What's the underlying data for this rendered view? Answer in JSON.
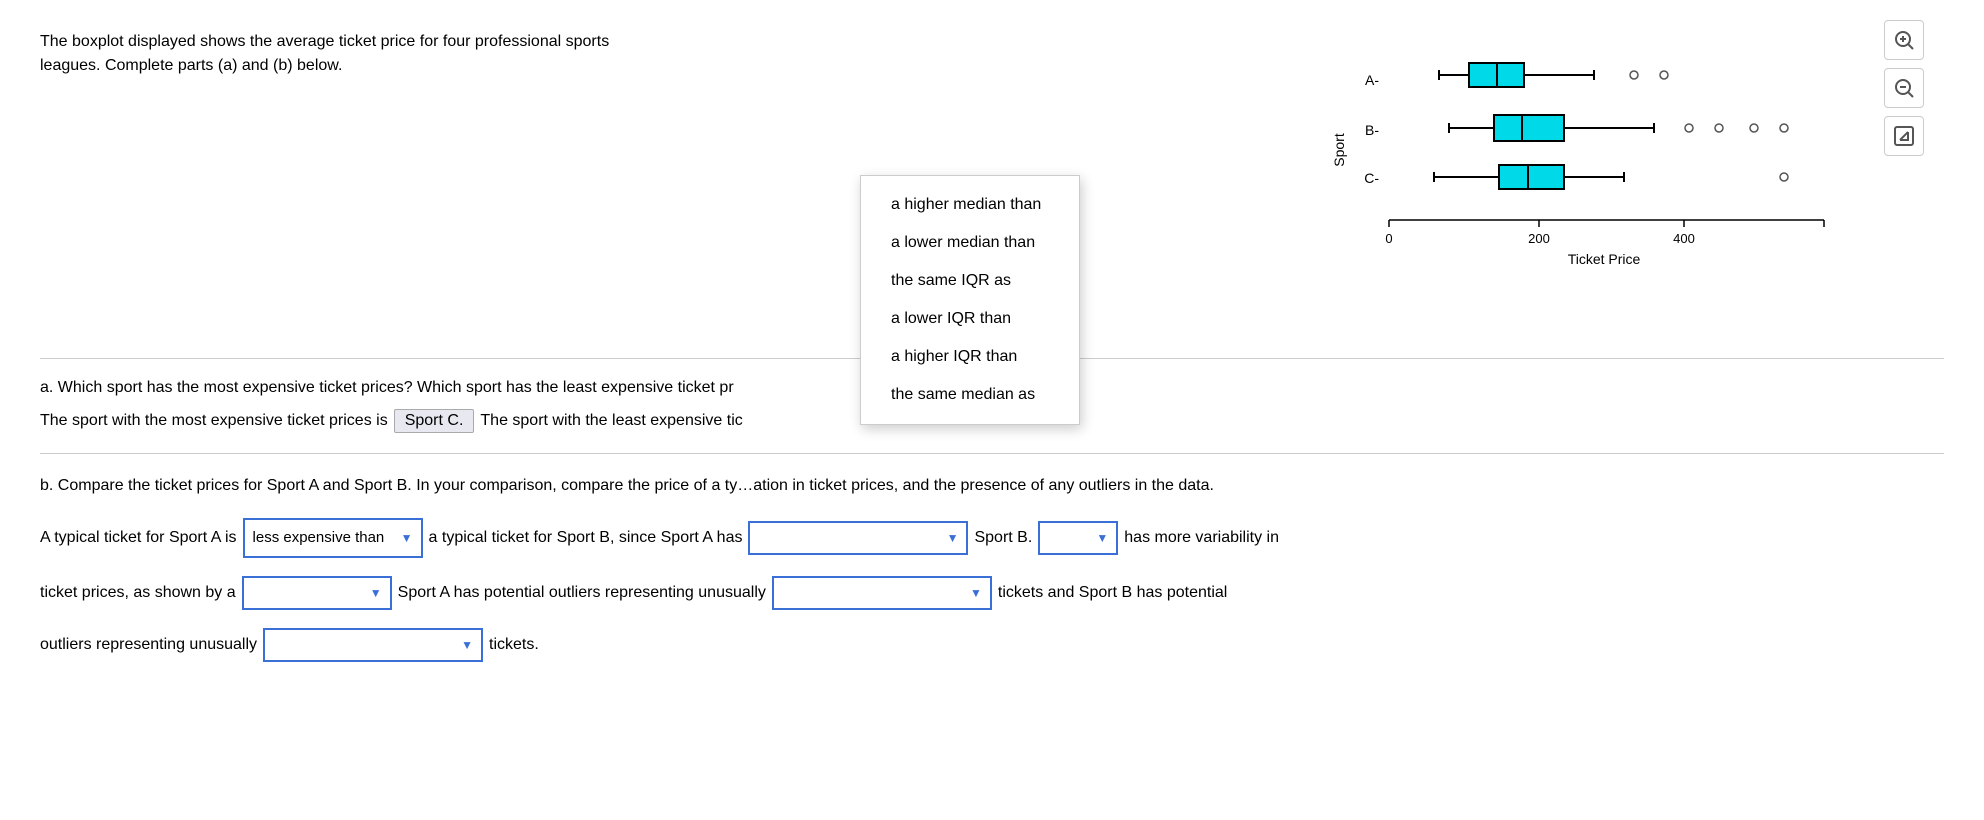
{
  "intro": {
    "text": "The boxplot displayed shows the average ticket price for four professional sports leagues. Complete parts (a) and (b) below."
  },
  "chart": {
    "title": "Ticket Price",
    "y_label": "Sport",
    "x_axis": {
      "values": [
        "0",
        "200",
        "400"
      ],
      "tick_positions": [
        0,
        200,
        400
      ]
    },
    "sports": [
      "A",
      "B",
      "C"
    ],
    "zoom_in_label": "🔍+",
    "zoom_out_label": "🔍-",
    "export_label": "⬡"
  },
  "dropdown_menu": {
    "items": [
      "a higher median than",
      "a lower median than",
      "the same IQR as",
      "a lower IQR than",
      "a higher IQR than",
      "the same median as"
    ]
  },
  "part_a": {
    "question": "a. Which sport has the most expensive ticket prices? Which sport has the least expensive ticket pr",
    "answer_prefix": "The sport with the most expensive ticket prices is",
    "most_expensive": "Sport C.",
    "answer_middle": "The sport with the least expensive tic",
    "answer_suffix": ""
  },
  "part_b": {
    "question": "b. Compare the ticket prices for Sport A and Sport B. In your comparison, compare the price of a ty",
    "question_suffix": "ation in ticket prices, and the presence of any outliers in the data."
  },
  "sentence1": {
    "prefix": "A typical ticket for Sport A is",
    "select1_value": "less expensive than",
    "middle": "a typical ticket for Sport B, since Sport A has",
    "select2_value": "",
    "suffix": "Sport B.",
    "select3_value": "",
    "end": "has more variability in"
  },
  "sentence2": {
    "prefix": "ticket prices, as shown by a",
    "select4_value": "",
    "middle": "Sport A has potential outliers representing unusually",
    "select5_value": "",
    "end": "tickets and Sport B has potential"
  },
  "sentence3": {
    "prefix": "outliers representing unusually",
    "select6_value": "",
    "suffix": "tickets."
  }
}
